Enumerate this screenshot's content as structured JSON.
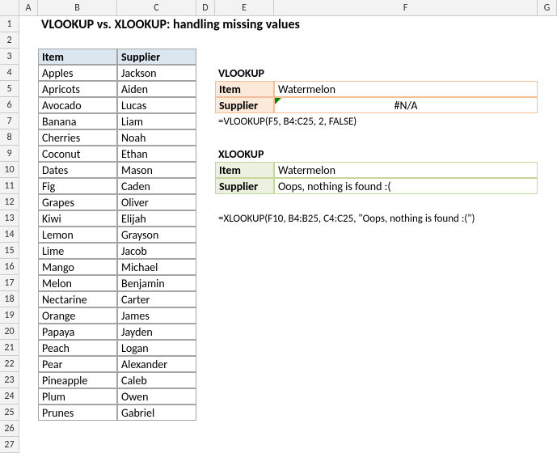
{
  "cols": [
    "",
    "A",
    "B",
    "C",
    "D",
    "E",
    "F",
    "G"
  ],
  "rows": [
    "1",
    "2",
    "3",
    "4",
    "5",
    "6",
    "7",
    "8",
    "9",
    "10",
    "11",
    "12",
    "13",
    "14",
    "15",
    "16",
    "17",
    "18",
    "19",
    "20",
    "21",
    "22",
    "23",
    "24",
    "25",
    "26",
    "27"
  ],
  "title": "VLOOKUP vs. XLOOKUP: handling missing values",
  "table": {
    "headers": {
      "item": "Item",
      "supplier": "Supplier"
    },
    "rows": [
      {
        "item": "Apples",
        "supplier": "Jackson"
      },
      {
        "item": "Apricots",
        "supplier": "Aiden"
      },
      {
        "item": "Avocado",
        "supplier": "Lucas"
      },
      {
        "item": "Banana",
        "supplier": "Liam"
      },
      {
        "item": "Cherries",
        "supplier": "Noah"
      },
      {
        "item": "Coconut",
        "supplier": "Ethan"
      },
      {
        "item": "Dates",
        "supplier": "Mason"
      },
      {
        "item": "Fig",
        "supplier": "Caden"
      },
      {
        "item": "Grapes",
        "supplier": "Oliver"
      },
      {
        "item": "Kiwi",
        "supplier": "Elijah"
      },
      {
        "item": "Lemon",
        "supplier": "Grayson"
      },
      {
        "item": "Lime",
        "supplier": "Jacob"
      },
      {
        "item": "Mango",
        "supplier": "Michael"
      },
      {
        "item": "Melon",
        "supplier": "Benjamin"
      },
      {
        "item": "Nectarine",
        "supplier": "Carter"
      },
      {
        "item": "Orange",
        "supplier": "James"
      },
      {
        "item": "Papaya",
        "supplier": "Jayden"
      },
      {
        "item": "Peach",
        "supplier": "Logan"
      },
      {
        "item": "Pear",
        "supplier": "Alexander"
      },
      {
        "item": "Pineapple",
        "supplier": "Caleb"
      },
      {
        "item": "Plum",
        "supplier": "Owen"
      },
      {
        "item": "Prunes",
        "supplier": "Gabriel"
      }
    ]
  },
  "vlookup": {
    "label": "VLOOKUP",
    "item_label": "Item",
    "item_value": "Watermelon",
    "supplier_label": "Supplier",
    "supplier_value": "#N/A",
    "formula": "=VLOOKUP(F5, B4:C25, 2, FALSE)"
  },
  "xlookup": {
    "label": "XLOOKUP",
    "item_label": "Item",
    "item_value": "Watermelon",
    "supplier_label": "Supplier",
    "supplier_value": "Oops, nothing is found :(",
    "formula": "=XLOOKUP(F10, B4:B25, C4:C25, \"Oops, nothing is found :(\")"
  }
}
